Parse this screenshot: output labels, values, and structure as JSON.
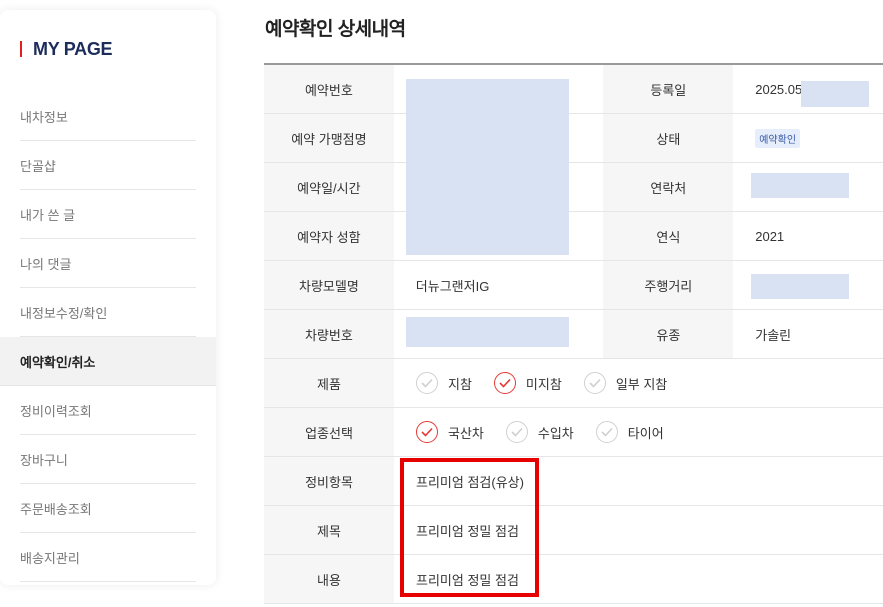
{
  "sidebar": {
    "title": "MY PAGE",
    "items": [
      {
        "label": "내차정보"
      },
      {
        "label": "단골샵"
      },
      {
        "label": "내가 쓴 글"
      },
      {
        "label": "나의 댓글"
      },
      {
        "label": "내정보수정/확인"
      },
      {
        "label": "예약확인/취소"
      },
      {
        "label": "정비이력조회"
      },
      {
        "label": "장바구니"
      },
      {
        "label": "주문배송조회"
      },
      {
        "label": "배송지관리"
      }
    ],
    "active_index": 5
  },
  "main": {
    "title": "예약확인 상세내역",
    "labels": {
      "reservation_number": "예약번호",
      "registered_date": "등록일",
      "store_name": "예약 가맹점명",
      "status": "상태",
      "datetime": "예약일/시간",
      "contact": "연락처",
      "reserver_name": "예약자 성함",
      "model_year": "연식",
      "car_model": "차량모델명",
      "mileage": "주행거리",
      "car_number": "차량번호",
      "fuel": "유종",
      "product": "제품",
      "business_type": "업종선택",
      "service_item": "정비항목",
      "subject": "제목",
      "content": "내용"
    },
    "values": {
      "registered_date": "2025.05.",
      "status": "예약확인",
      "model_year": "2021",
      "car_model": "더뉴그랜저IG",
      "fuel": "가솔린",
      "service_item": "프리미엄 점검(유상)",
      "subject": "프리미엄 정밀 점검",
      "content": "프리미엄 정밀 점검"
    },
    "product_options": [
      {
        "label": "지참",
        "checked": false
      },
      {
        "label": "미지참",
        "checked": true
      },
      {
        "label": "일부 지참",
        "checked": false
      }
    ],
    "business_options": [
      {
        "label": "국산차",
        "checked": true
      },
      {
        "label": "수입차",
        "checked": false
      },
      {
        "label": "타이어",
        "checked": false
      }
    ]
  },
  "colors": {
    "accent_red": "#e53935",
    "highlight_box": "#e60000",
    "brand_navy": "#1c2c5b",
    "redaction": "#d9e2f2"
  }
}
